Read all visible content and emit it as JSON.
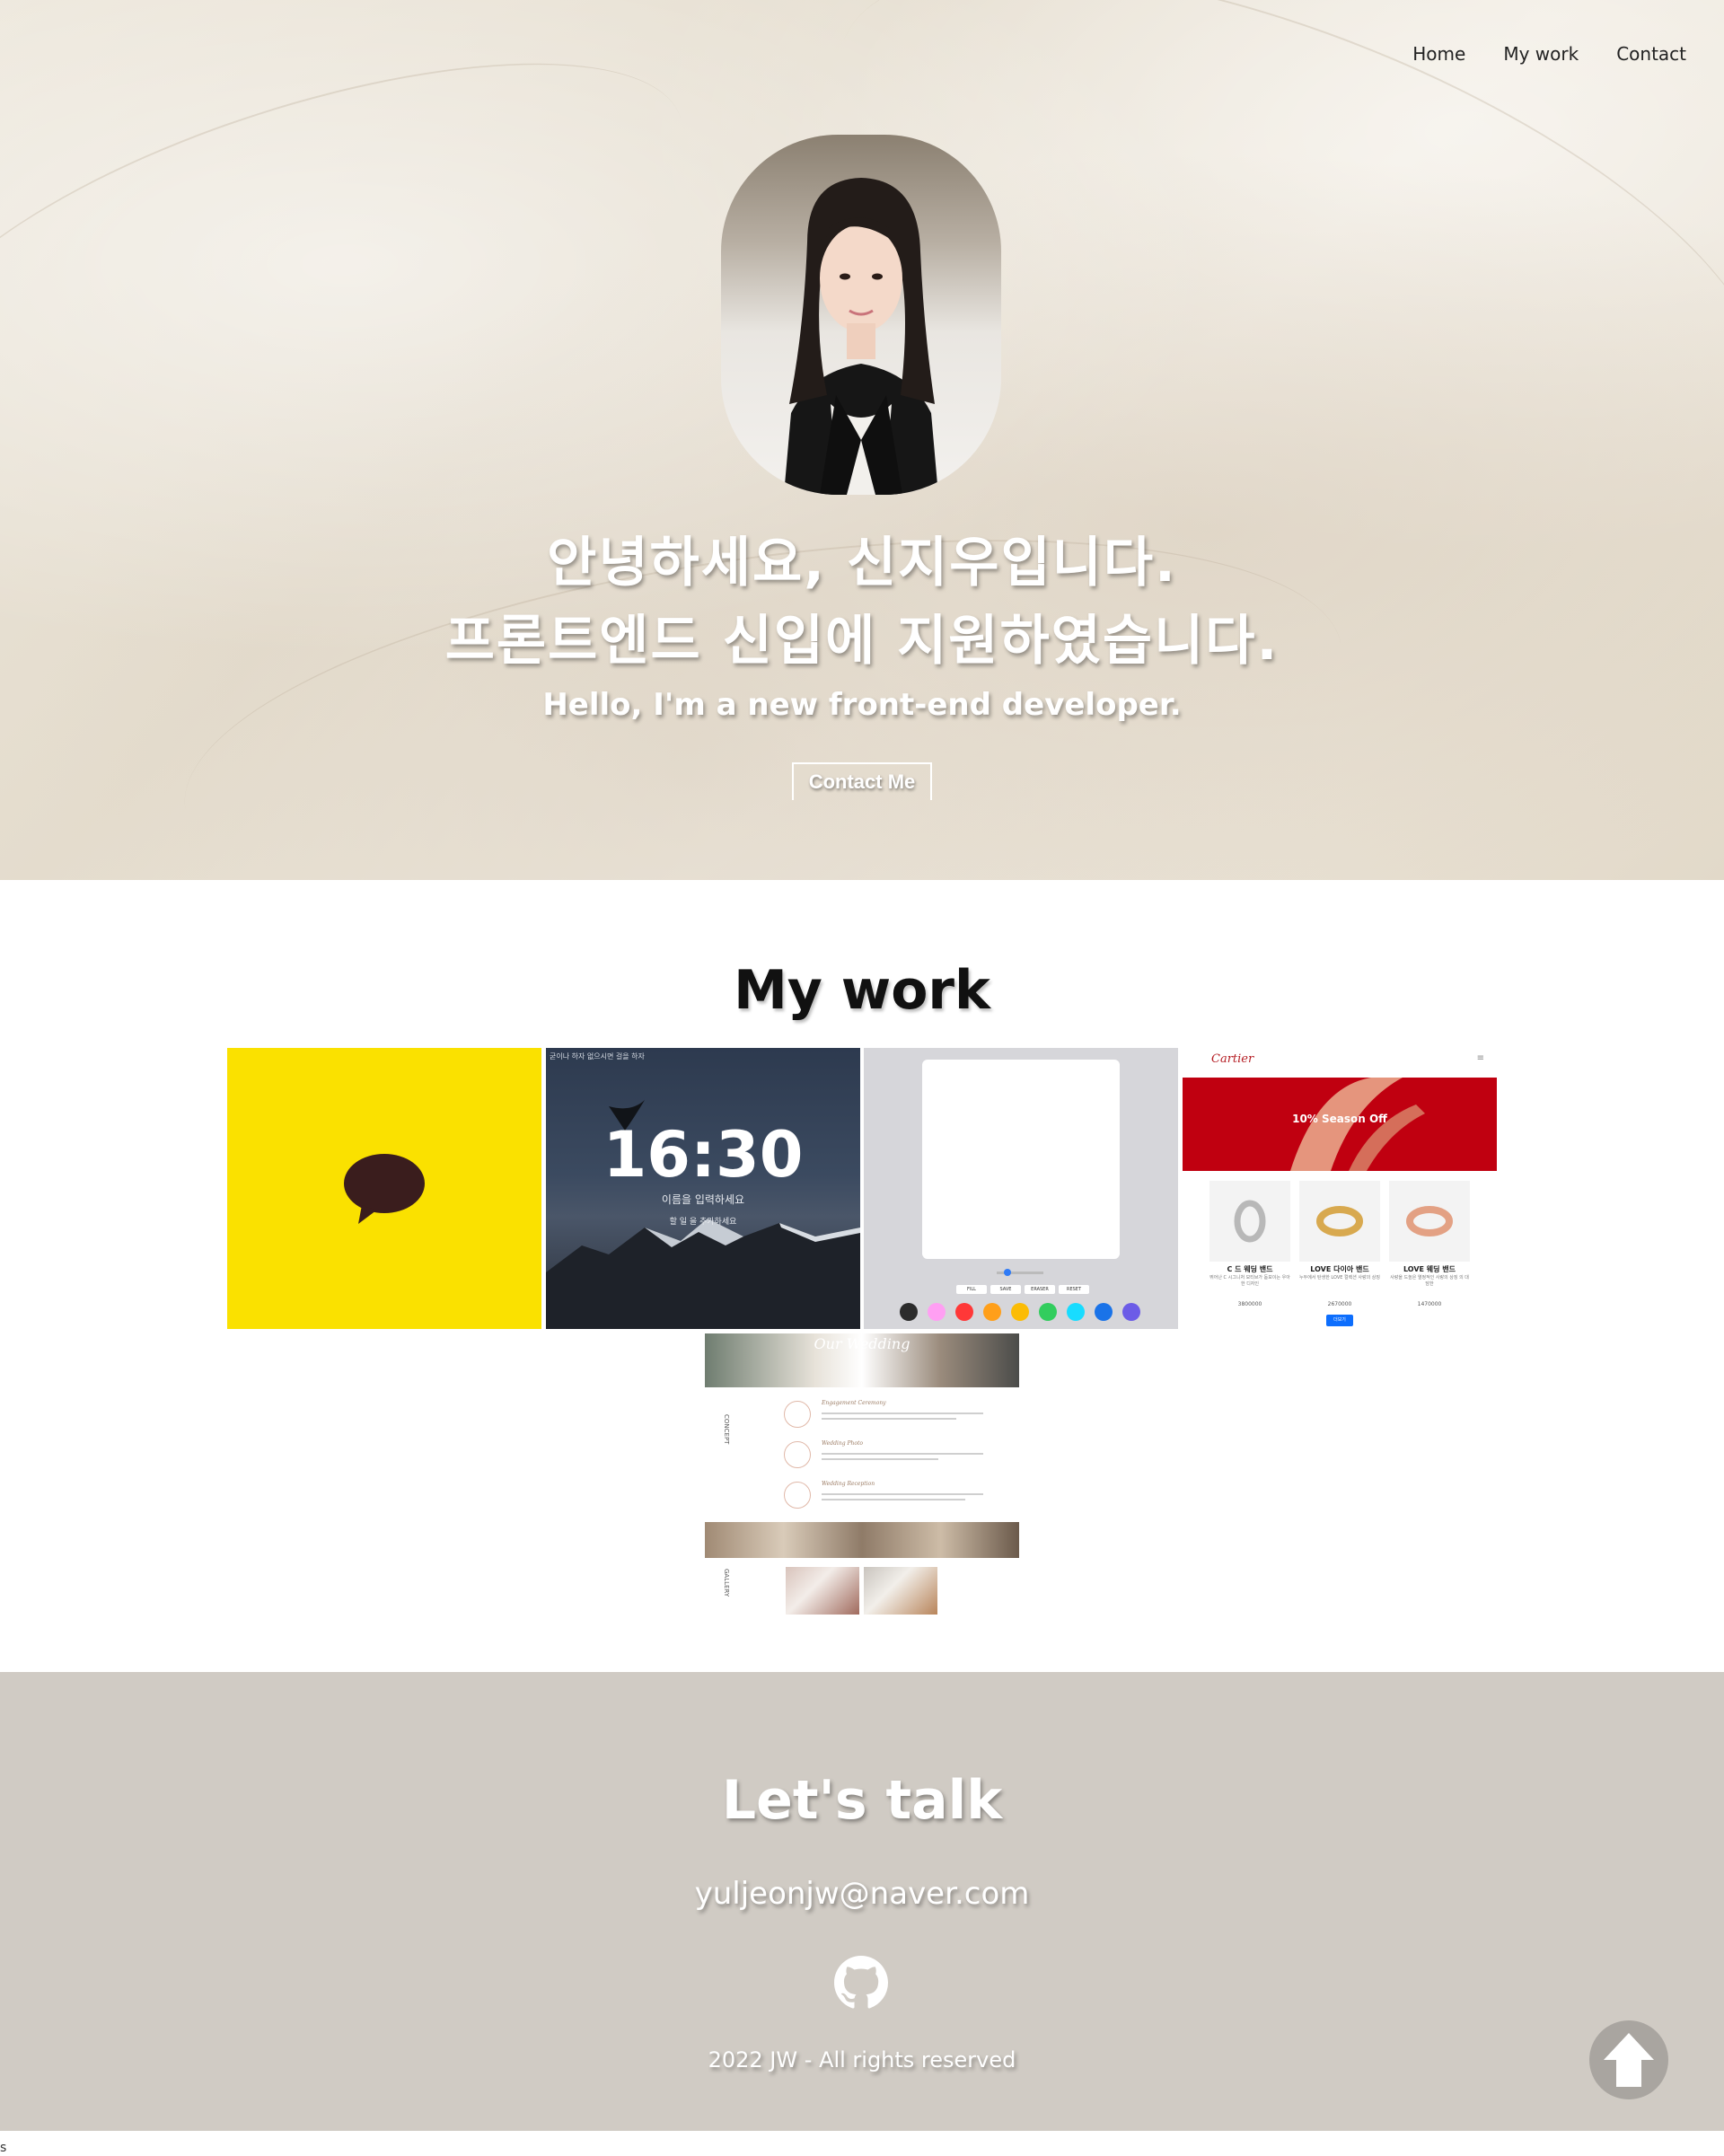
{
  "nav": {
    "home_label": "Home",
    "work_label": "My work",
    "contact_label": "Contact"
  },
  "hero": {
    "greeting_line1": "안녕하세요, 신지우입니다.",
    "greeting_line2": "프론트엔드 신입에 지원하였습니다.",
    "subtitle": "Hello, I'm a new front-end developer.",
    "contact_button_label": "Contact Me"
  },
  "work": {
    "title": "My work",
    "clock": {
      "caption": "굳이나 하자 없으시면 걸을 하자",
      "time": "16:30",
      "name_prompt": "이름을 입력하세요",
      "todo_prompt": "할 일 을 추가하세요"
    },
    "paint": {
      "buttons": [
        "FILL",
        "SAVE",
        "ERASER",
        "RESET"
      ],
      "colors": [
        "#2c2c2c",
        "#ff9ff3",
        "#ff3838",
        "#ff9f1a",
        "#fbbc05",
        "#32cd5e",
        "#18dcff",
        "#1a73e8",
        "#6c5ce7"
      ]
    },
    "cartier": {
      "logo": "Cartier",
      "menu_icon": "hamburger-icon",
      "banner_text": "10% Season Off",
      "products": [
        {
          "name": "C 드 웨딩 밴드",
          "desc": "뛰어난 C 시그니처 모티브가 돋보이는 우아한 디자인",
          "price": "3800000"
        },
        {
          "name": "LOVE 다이아 밴드",
          "desc": "누두에서 탄생한 LOVE 컬렉션 사랑의 상징",
          "price": "2670000"
        },
        {
          "name": "LOVE 웨딩 밴드",
          "desc": "사랑을 드높은 열정적인 사랑의 상징 의 대담한",
          "price": "1470000"
        }
      ],
      "more_label": "더보기"
    },
    "wedding": {
      "header_title": "Our Wedding",
      "concept_label": "CONCEPT",
      "gallery_label": "GALLERY",
      "items": [
        "Engagement Ceremony",
        "Wedding Photo",
        "Wedding Reception"
      ]
    }
  },
  "contact": {
    "title": "Let's talk",
    "email": "yuljeonjw@naver.com",
    "github_icon": "github-icon",
    "copyright": "2022 JW - All rights reserved"
  },
  "back_to_top_icon": "arrow-up-icon",
  "stray_char": "s",
  "colors": {
    "contact_bg": "#d0cbc4",
    "kakao_yellow": "#fae100",
    "cartier_red": "#c00010"
  }
}
